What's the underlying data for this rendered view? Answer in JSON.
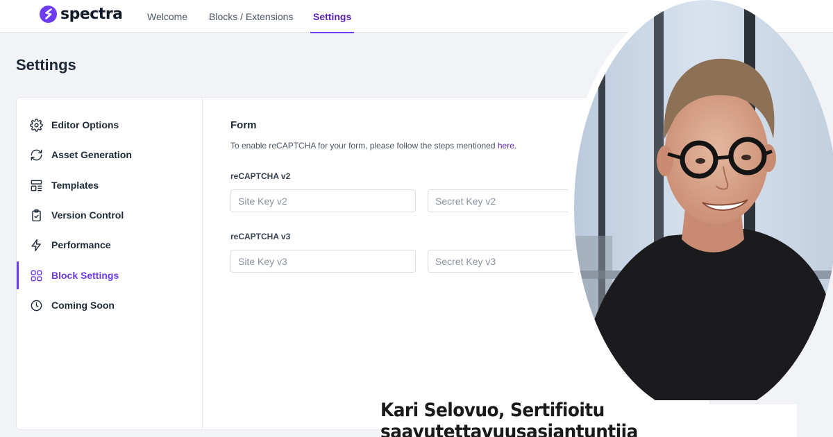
{
  "brand": {
    "name": "spectra",
    "logo_icon": "spectra-s-logo",
    "accent": "#6d3bf0"
  },
  "nav": {
    "tabs": [
      {
        "label": "Welcome",
        "active": false
      },
      {
        "label": "Blocks / Extensions",
        "active": false
      },
      {
        "label": "Settings",
        "active": true
      }
    ]
  },
  "page": {
    "title": "Settings"
  },
  "sidebar": {
    "items": [
      {
        "label": "Editor Options",
        "icon": "gear-icon",
        "active": false
      },
      {
        "label": "Asset Generation",
        "icon": "refresh-icon",
        "active": false
      },
      {
        "label": "Templates",
        "icon": "layout-template-icon",
        "active": false
      },
      {
        "label": "Version Control",
        "icon": "clipboard-check-icon",
        "active": false
      },
      {
        "label": "Performance",
        "icon": "lightning-icon",
        "active": false
      },
      {
        "label": "Block Settings",
        "icon": "grid-icon",
        "active": true
      },
      {
        "label": "Coming Soon",
        "icon": "clock-icon",
        "active": false
      }
    ]
  },
  "form": {
    "title": "Form",
    "description": "To enable reCAPTCHA for your form, please follow the steps mentioned",
    "link_text": "here.",
    "v2": {
      "label": "reCAPTCHA v2",
      "site_key_placeholder": "Site Key v2",
      "secret_key_placeholder": "Secret Key v2"
    },
    "v3": {
      "label": "reCAPTCHA v3",
      "site_key_placeholder": "Site Key v3",
      "secret_key_placeholder": "Secret Key v3"
    }
  },
  "caption": {
    "text": "Kari Selovuo, Sertifioitu saavutettavuusasiantuntija"
  }
}
